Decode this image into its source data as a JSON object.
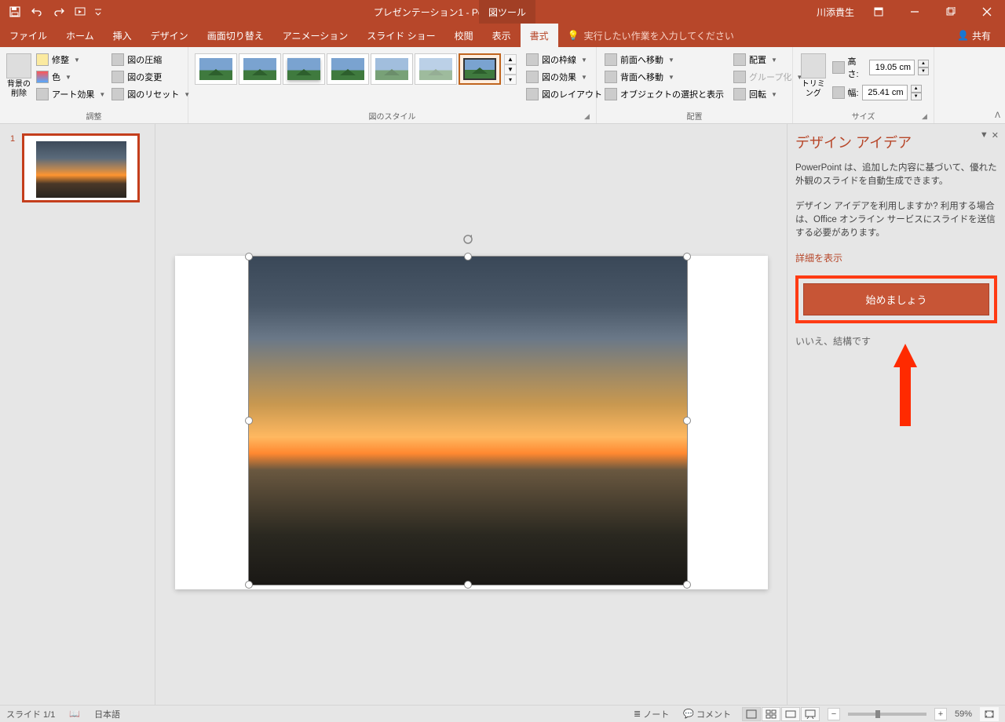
{
  "titlebar": {
    "doc_title": "プレゼンテーション1 - PowerPoint",
    "tool_tab": "図ツール",
    "user": "川添貴生"
  },
  "tabs": {
    "file": "ファイル",
    "home": "ホーム",
    "insert": "挿入",
    "design": "デザイン",
    "transitions": "画面切り替え",
    "animations": "アニメーション",
    "slideshow": "スライド ショー",
    "review": "校閲",
    "view": "表示",
    "format": "書式",
    "tell_me": "実行したい作業を入力してください",
    "share": "共有"
  },
  "ribbon": {
    "remove_bg": "背景の削除",
    "corrections": "修整",
    "color": "色",
    "artistic": "アート効果",
    "compress": "図の圧縮",
    "change": "図の変更",
    "reset": "図のリセット",
    "group_adjust": "調整",
    "group_styles": "図のスタイル",
    "border": "図の枠線",
    "effects": "図の効果",
    "layout": "図のレイアウト",
    "bring_forward": "前面へ移動",
    "send_backward": "背面へ移動",
    "selection_pane": "オブジェクトの選択と表示",
    "align": "配置",
    "group_cmd": "グループ化",
    "rotate": "回転",
    "group_arrange": "配置",
    "crop": "トリミング",
    "height_label": "高さ:",
    "height_value": "19.05 cm",
    "width_label": "幅:",
    "width_value": "25.41 cm",
    "group_size": "サイズ"
  },
  "thumbs": {
    "slide1_num": "1"
  },
  "pane": {
    "title": "デザイン アイデア",
    "desc": "PowerPoint は、追加した内容に基づいて、優れた外観のスライドを自動生成できます。",
    "prompt": "デザイン アイデアを利用しますか? 利用する場合は、Office オンライン サービスにスライドを送信する必要があります。",
    "details": "詳細を表示",
    "cta": "始めましょう",
    "decline": "いいえ、結構です"
  },
  "status": {
    "slide": "スライド 1/1",
    "lang": "日本語",
    "notes": "ノート",
    "comments": "コメント",
    "zoom": "59%"
  }
}
